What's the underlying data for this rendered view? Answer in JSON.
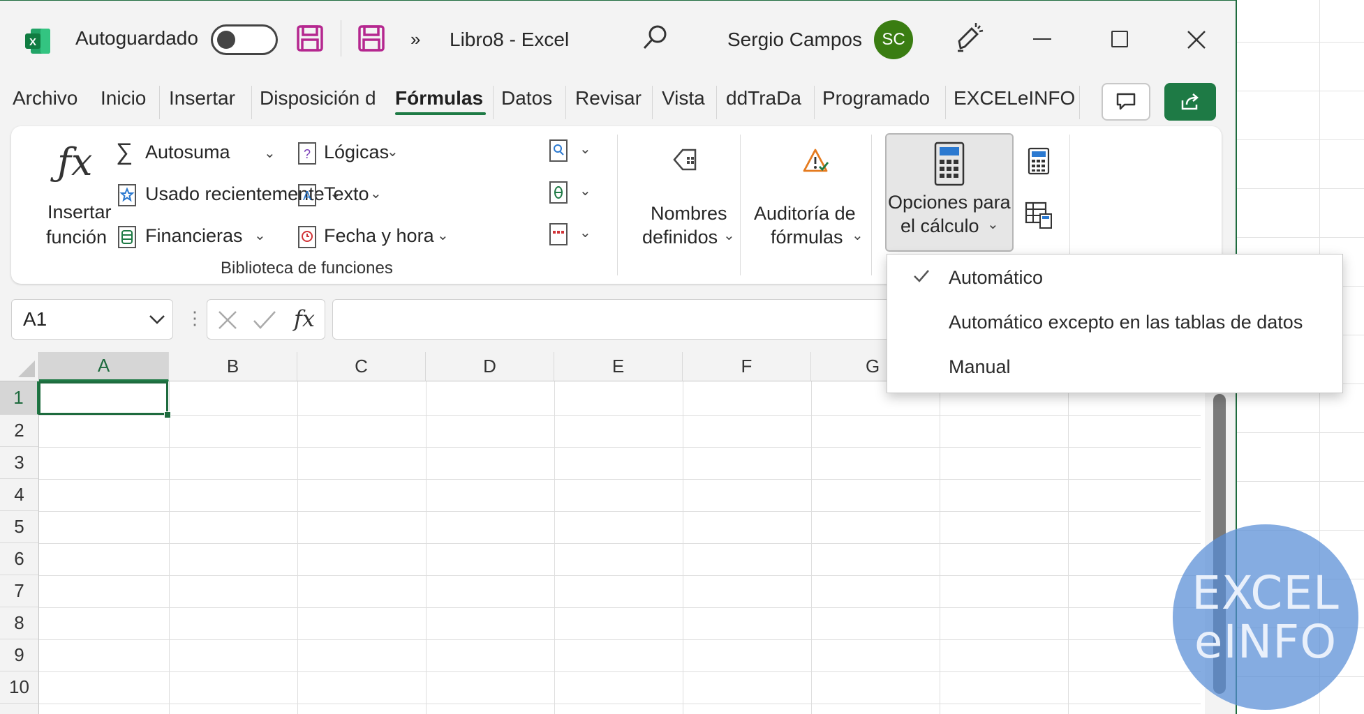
{
  "titlebar": {
    "autosave_label": "Autoguardado",
    "overflow_glyph": "»",
    "document_title": "Libro8  -  Excel",
    "user_name": "Sergio Campos",
    "user_initials": "SC"
  },
  "tabs": {
    "items": [
      "Archivo",
      "Inicio",
      "Insertar",
      "Disposición d",
      "Fórmulas",
      "Datos",
      "Revisar",
      "Vista",
      "ddTraDa",
      "Programado",
      "EXCELeINFO"
    ],
    "active": "Fórmulas"
  },
  "ribbon": {
    "insert_function": {
      "line1": "Insertar",
      "line2": "función"
    },
    "library": {
      "autosum": "Autosuma",
      "recent": "Usado recientemente",
      "financial": "Financieras",
      "logical": "Lógicas",
      "text": "Texto",
      "datetime": "Fecha y hora",
      "group_label": "Biblioteca de funciones"
    },
    "defined_names": {
      "line1": "Nombres",
      "line2": "definidos"
    },
    "auditing": {
      "line1": "Auditoría de",
      "line2": "fórmulas"
    },
    "calc_options": {
      "line1": "Opciones para",
      "line2": "el cálculo"
    }
  },
  "formula_bar": {
    "name_box": "A1",
    "fx_glyph": "fx",
    "formula": ""
  },
  "grid": {
    "columns": [
      "A",
      "B",
      "C",
      "D",
      "E",
      "F",
      "G"
    ],
    "rows": [
      "1",
      "2",
      "3",
      "4",
      "5",
      "6",
      "7",
      "8",
      "9",
      "10"
    ],
    "selected_cell": "A1"
  },
  "calc_menu": {
    "items": [
      {
        "label": "Automático",
        "checked": true
      },
      {
        "label": "Automático excepto en las tablas de datos",
        "checked": false
      },
      {
        "label": "Manual",
        "checked": false
      }
    ]
  },
  "watermark": {
    "line1": "EXCEL",
    "line2": "eINFO"
  },
  "colors": {
    "accent": "#1e7a45",
    "avatar": "#3a7d12",
    "save_icon": "#b5278f"
  }
}
